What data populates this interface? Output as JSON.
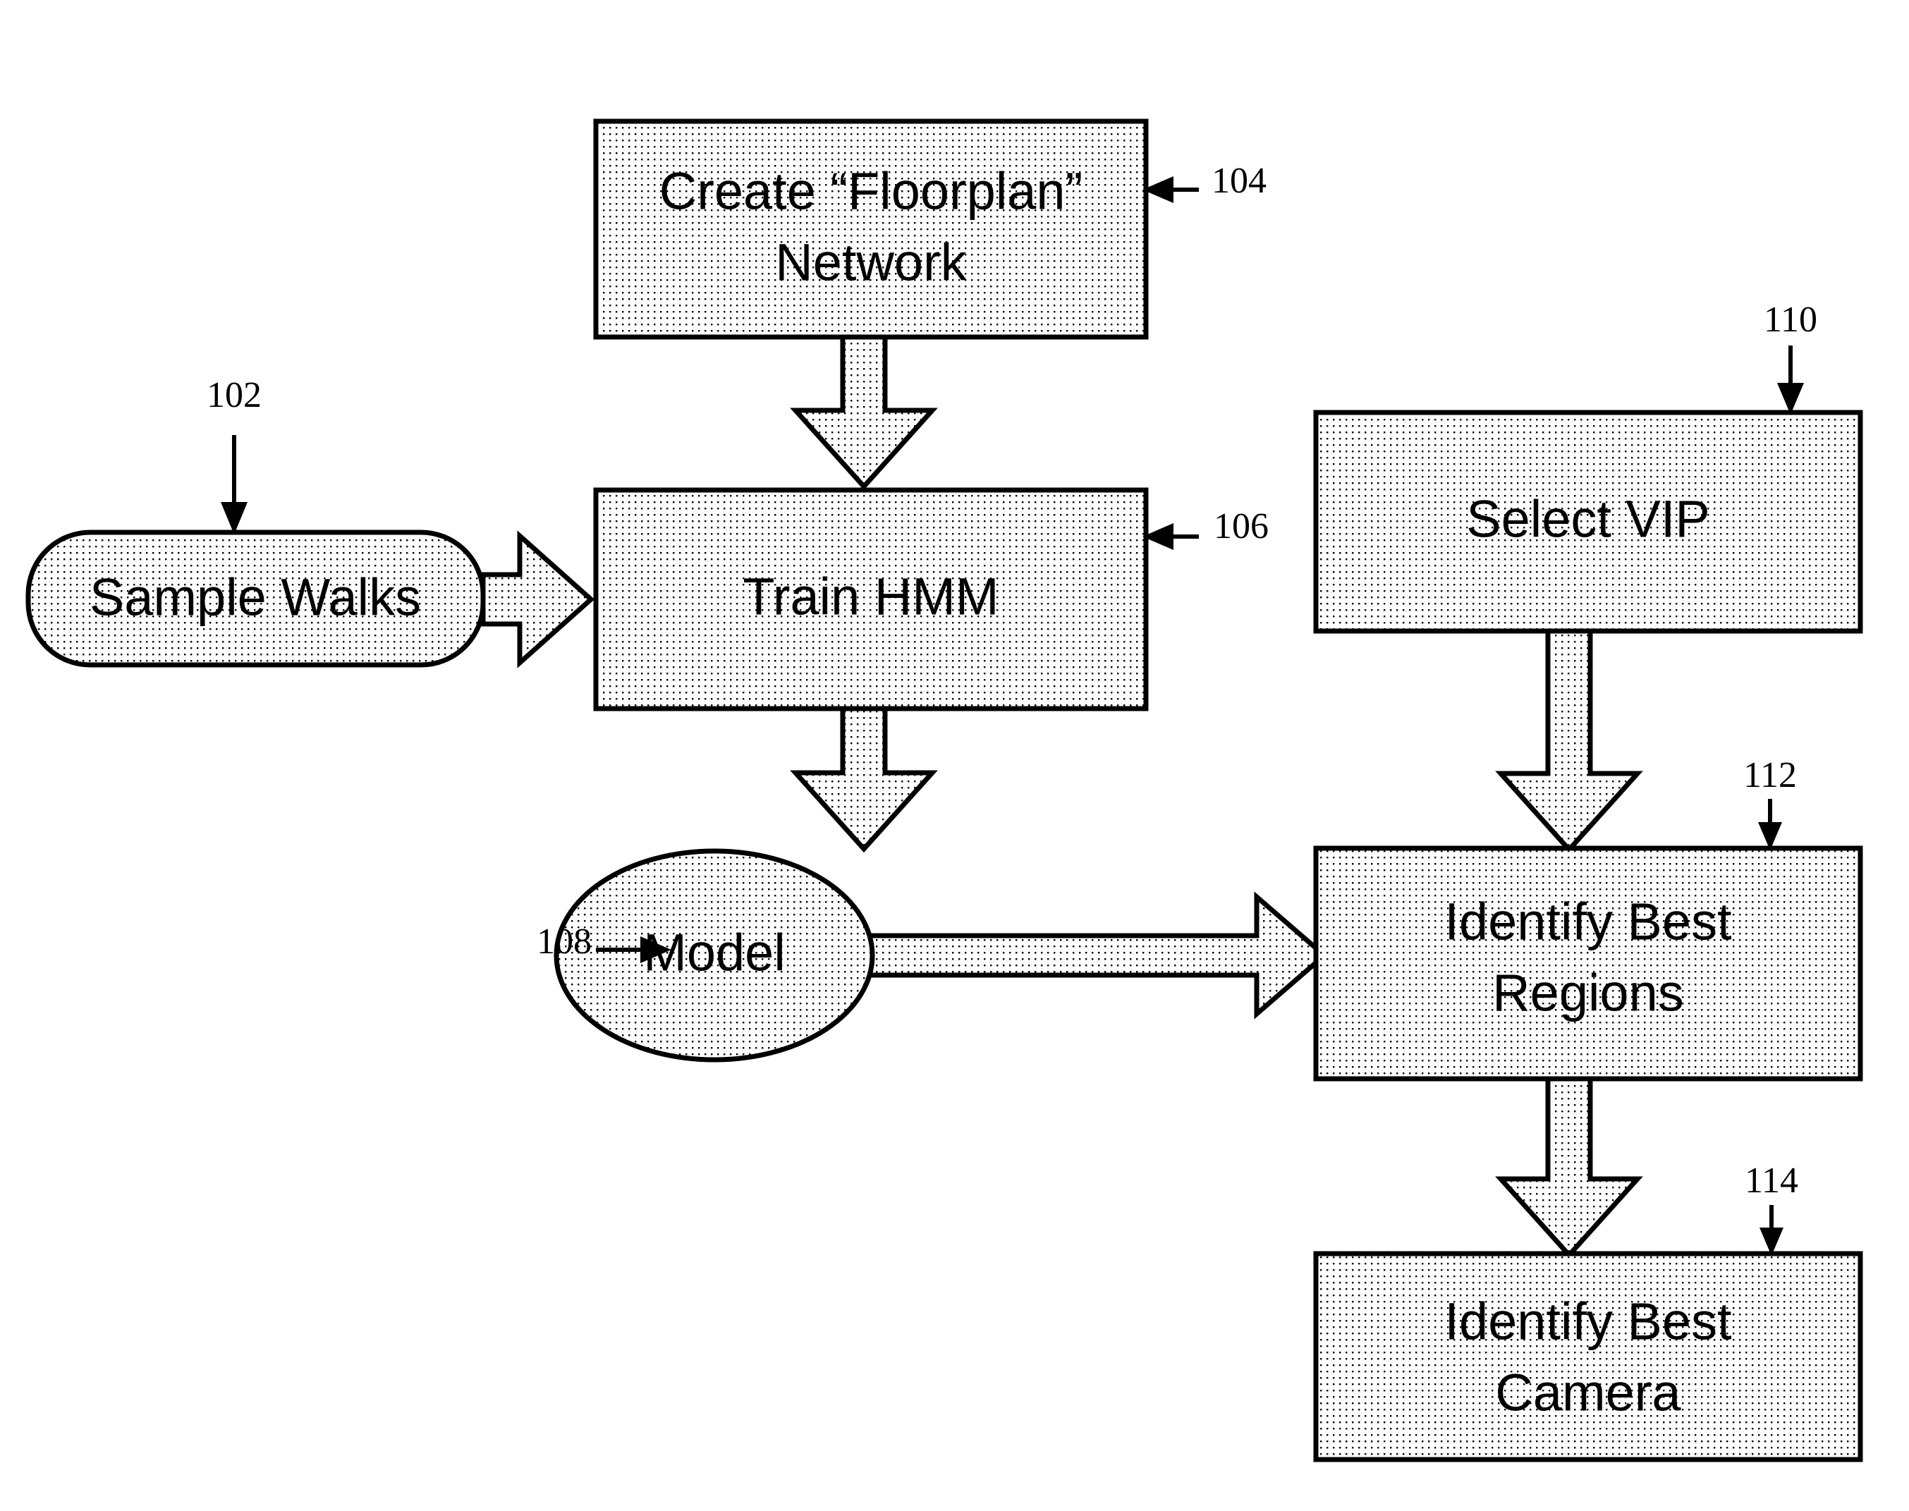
{
  "figure": {
    "kind": "patent-flowchart",
    "background_color": "#ffffff",
    "line_color": "#000000",
    "fill_pattern": "stipple-dots"
  },
  "nodes": {
    "sample_walks": {
      "label": "Sample Walks",
      "ref": "102",
      "shape": "rounded-rectangle"
    },
    "create_floorplan_network": {
      "label_line1": "Create “Floorplan”",
      "label_line2": "Network",
      "ref": "104",
      "shape": "rectangle"
    },
    "train_hmm": {
      "label": "Train HMM",
      "ref": "106",
      "shape": "rectangle"
    },
    "model": {
      "label": "Model",
      "ref": "108",
      "shape": "ellipse"
    },
    "select_vip": {
      "label": "Select VIP",
      "ref": "110",
      "shape": "rectangle"
    },
    "identify_best_regions": {
      "label_line1": "Identify Best",
      "label_line2": "Regions",
      "ref": "112",
      "shape": "rectangle"
    },
    "identify_best_camera": {
      "label_line1": "Identify Best",
      "label_line2": "Camera",
      "ref": "114",
      "shape": "rectangle"
    }
  },
  "connectors": [
    {
      "from": "create_floorplan_network",
      "to": "train_hmm",
      "style": "block-arrow",
      "direction": "down"
    },
    {
      "from": "sample_walks",
      "to": "train_hmm",
      "style": "block-arrow",
      "direction": "right"
    },
    {
      "from": "train_hmm",
      "to": "model",
      "style": "block-arrow",
      "direction": "down"
    },
    {
      "from": "model",
      "to": "identify_best_regions",
      "style": "block-arrow",
      "direction": "right"
    },
    {
      "from": "select_vip",
      "to": "identify_best_regions",
      "style": "block-arrow",
      "direction": "down"
    },
    {
      "from": "identify_best_regions",
      "to": "identify_best_camera",
      "style": "block-arrow",
      "direction": "down"
    }
  ],
  "reference_leaders": [
    {
      "ref": "102",
      "points_to": "sample_walks",
      "direction": "down"
    },
    {
      "ref": "104",
      "points_to": "create_floorplan_network",
      "direction": "left"
    },
    {
      "ref": "106",
      "points_to": "train_hmm",
      "direction": "left"
    },
    {
      "ref": "108",
      "points_to": "model",
      "direction": "right"
    },
    {
      "ref": "110",
      "points_to": "select_vip",
      "direction": "down"
    },
    {
      "ref": "112",
      "points_to": "identify_best_regions",
      "direction": "down"
    },
    {
      "ref": "114",
      "points_to": "identify_best_camera",
      "direction": "down"
    }
  ]
}
